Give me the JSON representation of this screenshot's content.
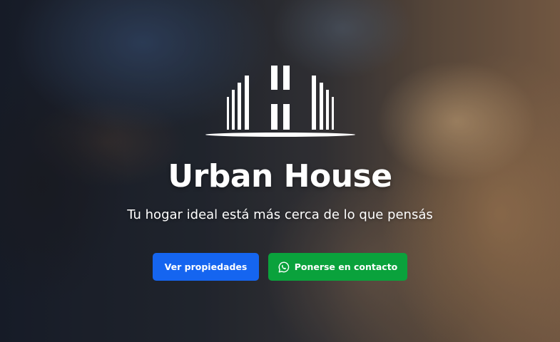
{
  "hero": {
    "logo_icon": "building-h-logo",
    "title": "Urban House",
    "subtitle": "Tu hogar ideal está más cerca de lo que pensás",
    "buttons": {
      "properties_label": "Ver propiedades",
      "contact_label": "Ponerse en contacto",
      "contact_icon": "whatsapp-icon"
    },
    "colors": {
      "primary": "#1565f0",
      "success": "#0aa23c",
      "text": "#ffffff"
    }
  }
}
